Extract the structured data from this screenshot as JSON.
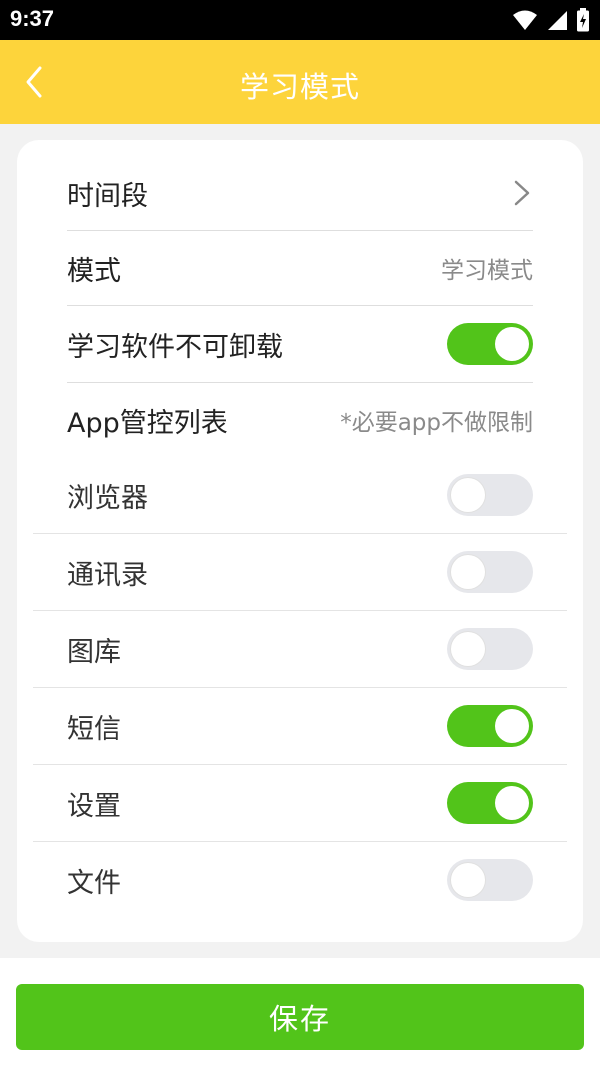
{
  "status_bar": {
    "time": "9:37"
  },
  "header": {
    "title": "学习模式",
    "back_icon": "chevron-left-icon"
  },
  "settings": {
    "time_period": {
      "label": "时间段",
      "icon": "chevron-right-icon"
    },
    "mode": {
      "label": "模式",
      "value": "学习模式"
    },
    "uninstall_lock": {
      "label": "学习软件不可卸载",
      "enabled": true
    },
    "app_control": {
      "label": "App管控列表",
      "note": "*必要app不做限制"
    },
    "apps": [
      {
        "label": "浏览器",
        "enabled": false
      },
      {
        "label": "通讯录",
        "enabled": false
      },
      {
        "label": "图库",
        "enabled": false
      },
      {
        "label": "短信",
        "enabled": true
      },
      {
        "label": "设置",
        "enabled": true
      },
      {
        "label": "文件",
        "enabled": false
      }
    ]
  },
  "actions": {
    "save_label": "保存"
  },
  "colors": {
    "header": "#fdd43b",
    "toggle_on": "#52c41a",
    "toggle_off": "#e6e7eb",
    "save_button": "#52c41a"
  }
}
